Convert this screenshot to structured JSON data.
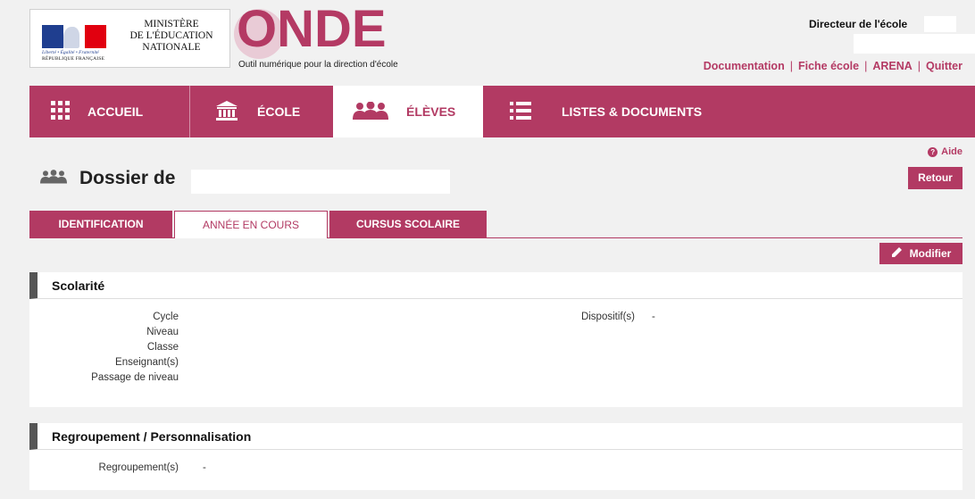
{
  "header": {
    "motto": "Liberté • Égalité • Fraternité",
    "republic": "RÉPUBLIQUE FRANÇAISE",
    "ministry_line1": "MINISTÈRE",
    "ministry_line2": "DE L'ÉDUCATION",
    "ministry_line3": "NATIONALE",
    "app_name_letters": [
      "O",
      "N",
      "D",
      "E"
    ],
    "tagline": "Outil numérique pour la direction d'école",
    "role": "Directeur de l'école",
    "links": [
      "Documentation",
      "Fiche école",
      "ARENA",
      "Quitter"
    ],
    "brand_color": "#b23a63"
  },
  "nav": {
    "items": [
      {
        "label": "ACCUEIL",
        "icon": "grid-icon"
      },
      {
        "label": "ÉCOLE",
        "icon": "building-icon"
      },
      {
        "label": "ÉLÈVES",
        "icon": "people-icon",
        "active": true
      },
      {
        "label": "LISTES & DOCUMENTS",
        "icon": "list-icon"
      }
    ]
  },
  "page": {
    "help_label": "Aide",
    "back_label": "Retour",
    "title_prefix": "Dossier de",
    "tabs": [
      {
        "label": "IDENTIFICATION"
      },
      {
        "label": "ANNÉE EN COURS",
        "active": true
      },
      {
        "label": "CURSUS SCOLAIRE"
      }
    ],
    "edit_label": "Modifier"
  },
  "scolarite": {
    "title": "Scolarité",
    "fields": [
      {
        "label": "Cycle",
        "value": ""
      },
      {
        "label": "Niveau",
        "value": ""
      },
      {
        "label": "Classe",
        "value": ""
      },
      {
        "label": "Enseignant(s)",
        "value": ""
      },
      {
        "label": "Passage de niveau",
        "value": ""
      }
    ],
    "dispositif_label": "Dispositif(s)",
    "dispositif_value": "-"
  },
  "regroupement": {
    "title": "Regroupement / Personnalisation",
    "label": "Regroupement(s)",
    "value": "-"
  }
}
